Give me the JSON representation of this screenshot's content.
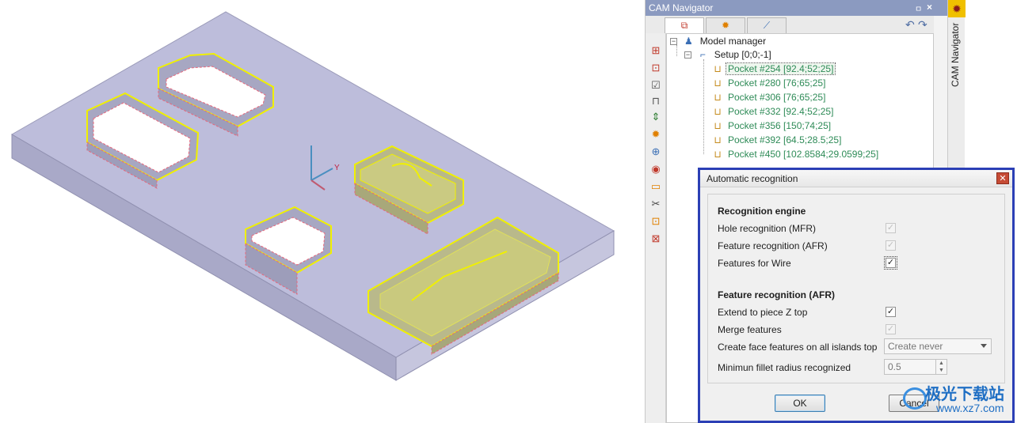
{
  "navigator": {
    "title": "CAM Navigator",
    "pin_glyph": "ㅁ",
    "close_glyph": "×",
    "side_label": "CAM Navigator",
    "tabs": [
      {
        "icon": "cube-icon",
        "glyph": "⧉"
      },
      {
        "icon": "gear-icon",
        "glyph": "✹"
      },
      {
        "icon": "tool-icon",
        "glyph": "⟋"
      }
    ],
    "undo_glyph": "↶",
    "redo_glyph": "↷",
    "tools": [
      {
        "icon": "stock-add-icon",
        "glyph": "⊞"
      },
      {
        "icon": "part-add-icon",
        "glyph": "⊡"
      },
      {
        "icon": "check-doc-icon",
        "glyph": "☑"
      },
      {
        "icon": "fixture-icon",
        "glyph": "⊓"
      },
      {
        "icon": "align-icon",
        "glyph": "⇕"
      },
      {
        "icon": "add-operation-icon",
        "glyph": "✹"
      },
      {
        "icon": "add-feature-icon",
        "glyph": "⊕"
      },
      {
        "icon": "simulate-icon",
        "glyph": "◉"
      },
      {
        "icon": "postprocessor-icon",
        "glyph": "▭"
      },
      {
        "icon": "wire-icon",
        "glyph": "✂"
      },
      {
        "icon": "add-setup-icon",
        "glyph": "⊡"
      },
      {
        "icon": "delete-icon",
        "glyph": "⊠"
      }
    ]
  },
  "tree": {
    "root_label": "Model manager",
    "setup_label": "Setup [0;0;-1]",
    "pockets": [
      "Pocket #254 [92.4;52;25]",
      "Pocket #280 [76;65;25]",
      "Pocket #306 [76;65;25]",
      "Pocket #332 [92.4;52;25]",
      "Pocket #356 [150;74;25]",
      "Pocket #392 [64.5;28.5;25]",
      "Pocket #450 [102.8584;29.0599;25]"
    ]
  },
  "dialog": {
    "title": "Automatic recognition",
    "section_engine": "Recognition engine",
    "hole_label": "Hole recognition (MFR)",
    "feature_label": "Feature recognition (AFR)",
    "wire_label": "Features for Wire",
    "section_afr": "Feature recognition (AFR)",
    "extend_label": "Extend to piece Z top",
    "merge_label": "Merge features",
    "face_label": "Create face features on all islands top",
    "face_value": "Create never",
    "fillet_label": "Minimun fillet radius recognized",
    "fillet_value": "0.5",
    "ok_label": "OK",
    "cancel_label": "Cancel",
    "check_glyph": "✓"
  },
  "viewport": {
    "axis_y_label": "Y"
  },
  "watermark": {
    "brand": "极光下载站",
    "url": "www.xz7.com"
  },
  "colors": {
    "plate": "#b9b9d6",
    "feature_outline": "#f0f000",
    "selection": "#2b3fb5",
    "pocket_text": "#2e8b57"
  }
}
